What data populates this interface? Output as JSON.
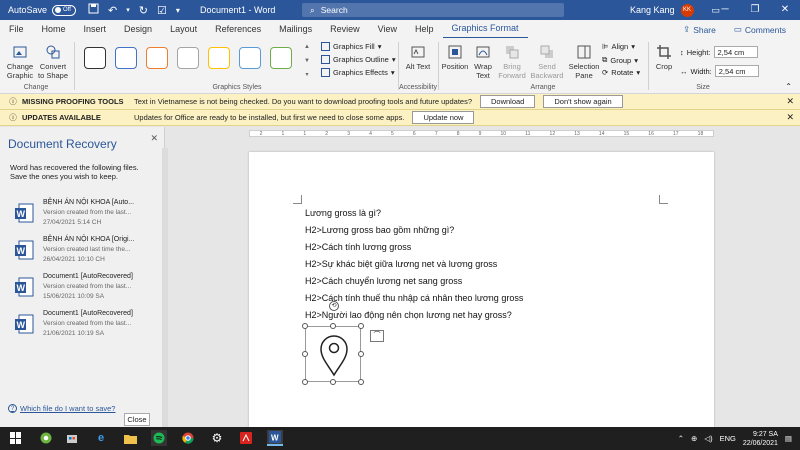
{
  "titlebar": {
    "autosave_label": "AutoSave",
    "autosave_state": "Off",
    "doc_title": "Document1 - Word",
    "search_placeholder": "Search",
    "user_name": "Kang Kang",
    "user_initials": "KK"
  },
  "menu": {
    "tabs": [
      "File",
      "Home",
      "Insert",
      "Design",
      "Layout",
      "References",
      "Mailings",
      "Review",
      "View",
      "Help",
      "Graphics Format"
    ],
    "active": "Graphics Format",
    "share": "Share",
    "comments": "Comments"
  },
  "ribbon": {
    "change_graphic": "Change Graphic",
    "convert_shape": "Convert to Shape",
    "group_change": "Change",
    "group_graphics_styles": "Graphics Styles",
    "graphics_fill": "Graphics Fill",
    "graphics_outline": "Graphics Outline",
    "graphics_effects": "Graphics Effects",
    "alt_text": "Alt Text",
    "group_accessibility": "Accessibility",
    "position": "Position",
    "wrap_text": "Wrap Text",
    "bring_forward": "Bring Forward",
    "send_backward": "Send Backward",
    "selection_pane": "Selection Pane",
    "align": "Align",
    "group": "Group",
    "rotate": "Rotate",
    "group_arrange": "Arrange",
    "crop": "Crop",
    "height_label": "Height:",
    "height_value": "2,54 cm",
    "width_label": "Width:",
    "width_value": "2,54 cm",
    "group_size": "Size",
    "style_colors": [
      "#333333",
      "#4472c4",
      "#ed7d31",
      "#a5a5a5",
      "#ffc000",
      "#5b9bd5",
      "#70ad47"
    ]
  },
  "notifications": {
    "proofing": {
      "title": "MISSING PROOFING TOOLS",
      "message": "Text in Vietnamese is not being checked. Do you want to download proofing tools and future updates?",
      "button1": "Download",
      "button2": "Don't show again"
    },
    "updates": {
      "title": "UPDATES AVAILABLE",
      "message": "Updates for Office are ready to be installed, but first we need to close some apps.",
      "button1": "Update now"
    }
  },
  "recovery": {
    "title": "Document Recovery",
    "description": "Word has recovered the following files. Save the ones you wish to keep.",
    "files": [
      {
        "name": "BỆNH ÁN NỘI KHOA  [Auto...",
        "line1": "Version created from the last...",
        "line2": "27/04/2021 5:14 CH"
      },
      {
        "name": "BỆNH ÁN NỘI KHOA  [Origi...",
        "line1": "Version created last time the...",
        "line2": "26/04/2021 10:10 CH"
      },
      {
        "name": "Document1  [AutoRecovered]",
        "line1": "Version created from the last...",
        "line2": "15/06/2021 10:09 SA"
      },
      {
        "name": "Document1  [AutoRecovered]",
        "line1": "Version created from the last...",
        "line2": "21/06/2021 10:19 SA"
      }
    ],
    "help_link": "Which file do I want to save?",
    "close_button": "Close"
  },
  "document": {
    "lines": [
      "Lương gross là gì?",
      "H2>Lương gross bao gồm những gì?",
      "H2>Cách tính lương gross",
      "H2>Sự khác biệt giữa lương net và lương gross",
      "H2>Cách chuyển lương net sang gross",
      "H2>Cách tính thuế thu nhập cá nhân theo lương gross",
      "H2>Người lao động nên chọn lương net hay gross?"
    ],
    "selected_icon": "map-pin-icon"
  },
  "ruler": {
    "ticks": [
      "2",
      "1",
      "1",
      "2",
      "3",
      "4",
      "5",
      "6",
      "7",
      "8",
      "9",
      "10",
      "11",
      "12",
      "13",
      "14",
      "15",
      "16",
      "17",
      "18"
    ]
  },
  "taskbar": {
    "language": "ENG",
    "time": "9:27 SA",
    "date": "22/06/2021"
  }
}
